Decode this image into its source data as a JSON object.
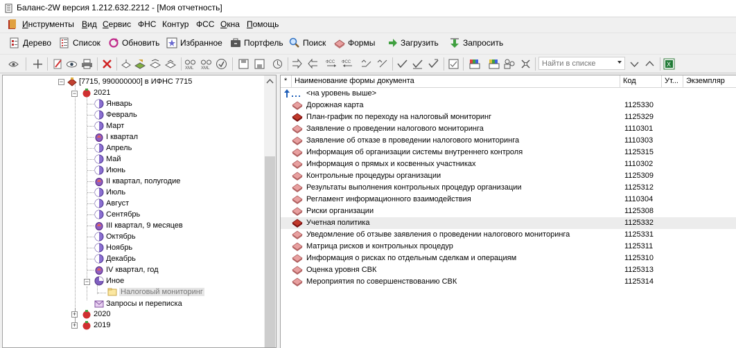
{
  "window": {
    "title": "Баланс-2W  версия 1.212.632.2212 - [Моя отчетность]"
  },
  "menu": [
    {
      "label": "Инструменты",
      "accel": "И",
      "rest": "нструменты"
    },
    {
      "label": "Вид",
      "accel": "В",
      "rest": "ид"
    },
    {
      "label": "Сервис",
      "accel": "С",
      "rest": "ервис"
    },
    {
      "label": "ФНС",
      "accel": "",
      "rest": "ФНС"
    },
    {
      "label": "Контур",
      "accel": "",
      "rest": "Контур"
    },
    {
      "label": "ФСС",
      "accel": "",
      "rest": "ФСС"
    },
    {
      "label": "Окна",
      "accel": "О",
      "rest": "кна"
    },
    {
      "label": "Помощь",
      "accel": "П",
      "rest": "омощь"
    }
  ],
  "toolbar": {
    "tree": "Дерево",
    "list": "Список",
    "refresh": "Обновить",
    "favorites": "Избранное",
    "portfolio": "Портфель",
    "search": "Поиск",
    "forms": "Формы",
    "load": "Загрузить",
    "request": "Запросить"
  },
  "search_placeholder": "Найти в списке",
  "tree": {
    "root": "[7715, 990000000] в ИФНС 7715",
    "year_2021": "2021",
    "months": [
      {
        "label": "Январь",
        "icon": "month-icon"
      },
      {
        "label": "Февраль",
        "icon": "month-icon"
      },
      {
        "label": "Март",
        "icon": "month-icon"
      },
      {
        "label": "I квартал",
        "icon": "quarter-icon"
      },
      {
        "label": "Апрель",
        "icon": "month-icon"
      },
      {
        "label": "Май",
        "icon": "month-icon"
      },
      {
        "label": "Июнь",
        "icon": "month-icon"
      },
      {
        "label": "II квартал, полугодие",
        "icon": "quarter-icon"
      },
      {
        "label": "Июль",
        "icon": "month-icon"
      },
      {
        "label": "Август",
        "icon": "month-icon"
      },
      {
        "label": "Сентябрь",
        "icon": "month-icon"
      },
      {
        "label": "III квартал, 9 месяцев",
        "icon": "quarter-icon"
      },
      {
        "label": "Октябрь",
        "icon": "month-icon"
      },
      {
        "label": "Ноябрь",
        "icon": "month-icon"
      },
      {
        "label": "Декабрь",
        "icon": "month-icon"
      },
      {
        "label": "IV квартал, год",
        "icon": "quarter-icon"
      }
    ],
    "other": "Иное",
    "tax_monitoring": "Налоговый мониторинг",
    "requests": "Запросы и переписка",
    "year_2020": "2020",
    "year_2019": "2019"
  },
  "list": {
    "columns": [
      "*",
      "Наименование формы документа",
      "Код",
      "Ут...",
      "Экземпляр"
    ],
    "up_level": "<на уровень выше>",
    "rows": [
      {
        "name": "Дорожная карта",
        "code": "1125330",
        "red": false
      },
      {
        "name": "План-график по переходу на налоговый мониторинг",
        "code": "1125329",
        "red": true
      },
      {
        "name": "Заявление о проведении налогового мониторинга",
        "code": "1110301",
        "red": false
      },
      {
        "name": "Заявление  об отказе в проведении налогового мониторинга",
        "code": "1110303",
        "red": false
      },
      {
        "name": "Информация об организации системы внутреннего контроля",
        "code": "1125315",
        "red": false
      },
      {
        "name": "Информация о прямых и косвенных участниках",
        "code": "1110302",
        "red": false
      },
      {
        "name": "Контрольные процедуры организации",
        "code": "1125309",
        "red": false
      },
      {
        "name": "Результаты выполнения контрольных процедур организации",
        "code": "1125312",
        "red": false
      },
      {
        "name": "Регламент информационного взаимодействия",
        "code": "1110304",
        "red": false
      },
      {
        "name": "Риски организации",
        "code": "1125308",
        "red": false
      },
      {
        "name": "Учетная политика",
        "code": "1125332",
        "red": true
      },
      {
        "name": "Уведомление об отзыве заявления о проведении налогового мониторинга",
        "code": "1125331",
        "red": false
      },
      {
        "name": "Матрица рисков и контрольных процедур",
        "code": "1125311",
        "red": false
      },
      {
        "name": "Информация о рисках по отдельным сделкам и операциям",
        "code": "1125310",
        "red": false
      },
      {
        "name": "Оценка уровня СВК",
        "code": "1125313",
        "red": false
      },
      {
        "name": "Мероприятия по совершенствованию СВК",
        "code": "1125314",
        "red": false
      }
    ]
  },
  "colors": {
    "selected_row": "#ececec",
    "book_red": "#c0392b",
    "book_pink": "#e8a0a0"
  }
}
